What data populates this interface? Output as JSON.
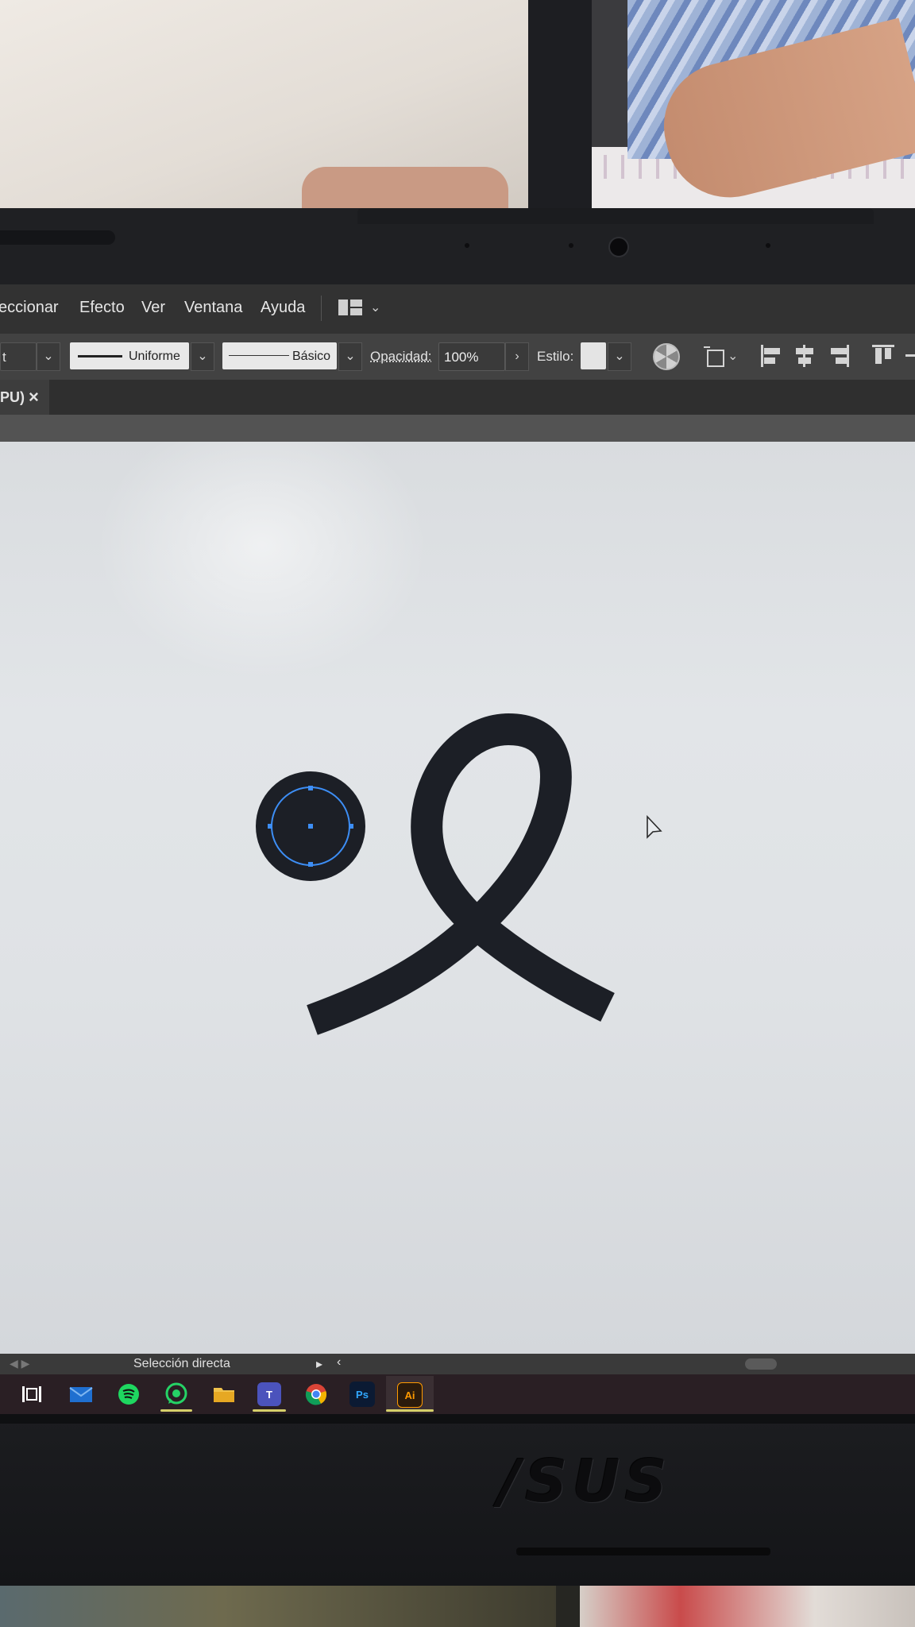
{
  "menubar": {
    "items": [
      "eccionar",
      "Efecto",
      "Ver",
      "Ventana",
      "Ayuda"
    ],
    "workspace_icon": "workspace-switcher-icon"
  },
  "controlbar": {
    "partial_select_value": "t",
    "stroke_profile": "Uniforme",
    "brush_definition": "Básico",
    "opacity_label": "Opacidad:",
    "opacity_value": "100%",
    "style_label": "Estilo:"
  },
  "document_tab": {
    "title_fragment": "PU)",
    "close_glyph": "×"
  },
  "canvas": {
    "background_color": "#e0e3e6",
    "artwork_color": "#1c1f26",
    "selection_color": "#3d8ef5"
  },
  "statusbar": {
    "tool_name": "Selección directa"
  },
  "taskbar": {
    "apps": [
      "task-view-icon",
      "mail-icon",
      "spotify-icon",
      "whatsapp-icon",
      "file-explorer-icon",
      "teams-icon",
      "chrome-icon",
      "photoshop-icon",
      "illustrator-icon"
    ],
    "photoshop_label": "Ps",
    "illustrator_label": "Ai",
    "teams_label": "T"
  },
  "brand": {
    "logo_text": "/SUS"
  }
}
